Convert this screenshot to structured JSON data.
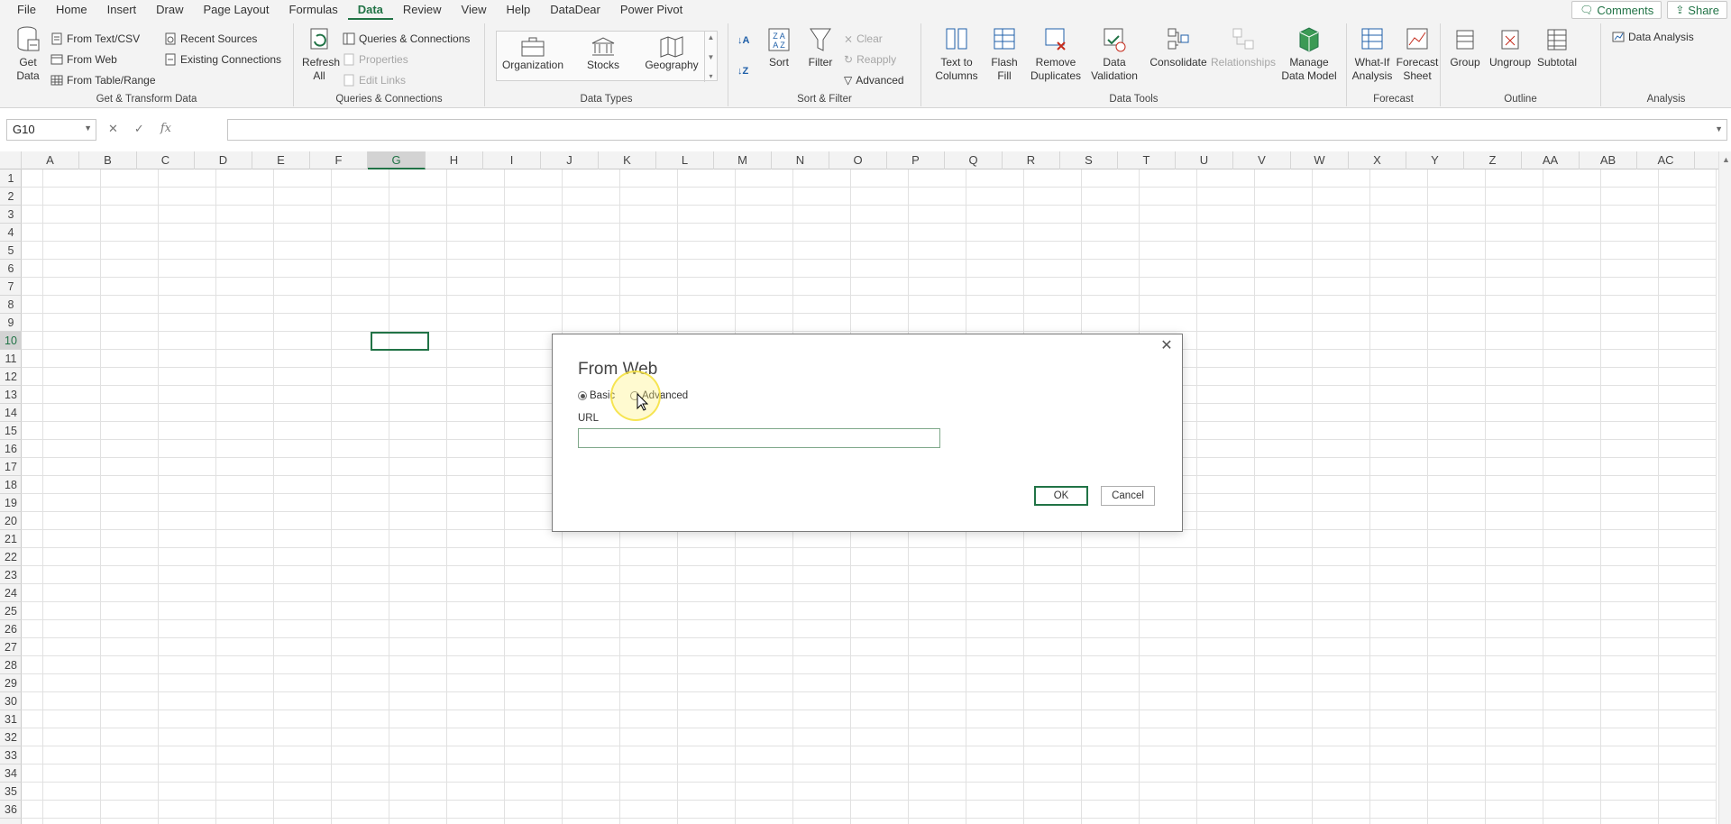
{
  "menu": {
    "tabs": [
      "File",
      "Home",
      "Insert",
      "Draw",
      "Page Layout",
      "Formulas",
      "Data",
      "Review",
      "View",
      "Help",
      "DataDear",
      "Power Pivot"
    ],
    "active": "Data",
    "comments": "Comments",
    "share": "Share"
  },
  "ribbon": {
    "get_transform": {
      "get_data": "Get Data",
      "from_text_csv": "From Text/CSV",
      "from_web": "From Web",
      "from_table": "From Table/Range",
      "recent_sources": "Recent Sources",
      "existing_connections": "Existing Connections",
      "label": "Get & Transform Data"
    },
    "queries": {
      "refresh_all": "Refresh All",
      "queries_connections": "Queries & Connections",
      "properties": "Properties",
      "edit_links": "Edit Links",
      "label": "Queries & Connections"
    },
    "data_types": {
      "organization": "Organization",
      "stocks": "Stocks",
      "geography": "Geography",
      "label": "Data Types"
    },
    "sort_filter": {
      "sort": "Sort",
      "filter": "Filter",
      "clear": "Clear",
      "reapply": "Reapply",
      "advanced": "Advanced",
      "label": "Sort & Filter"
    },
    "data_tools": {
      "text_to_columns": "Text to Columns",
      "flash_fill": "Flash Fill",
      "remove_duplicates": "Remove Duplicates",
      "data_validation": "Data Validation",
      "consolidate": "Consolidate",
      "relationships": "Relationships",
      "manage_data_model": "Manage Data Model",
      "label": "Data Tools"
    },
    "forecast": {
      "what_if": "What-If Analysis",
      "forecast_sheet": "Forecast Sheet",
      "label": "Forecast"
    },
    "outline": {
      "group": "Group",
      "ungroup": "Ungroup",
      "subtotal": "Subtotal",
      "label": "Outline"
    },
    "analysis": {
      "data_analysis": "Data Analysis",
      "label": "Analysis"
    }
  },
  "formula_bar": {
    "name_box": "G10",
    "formula": ""
  },
  "grid": {
    "columns": [
      "A",
      "B",
      "C",
      "D",
      "E",
      "F",
      "G",
      "H",
      "I",
      "J",
      "K",
      "L",
      "M",
      "N",
      "O",
      "P",
      "Q",
      "R",
      "S",
      "T",
      "U",
      "V",
      "W",
      "X",
      "Y",
      "Z",
      "AA",
      "AB",
      "AC"
    ],
    "rows": 36,
    "selected_col": "G",
    "selected_row": 10
  },
  "dialog": {
    "title": "From Web",
    "basic": "Basic",
    "advanced": "Advanced",
    "url_label": "URL",
    "url_value": "",
    "ok": "OK",
    "cancel": "Cancel"
  }
}
